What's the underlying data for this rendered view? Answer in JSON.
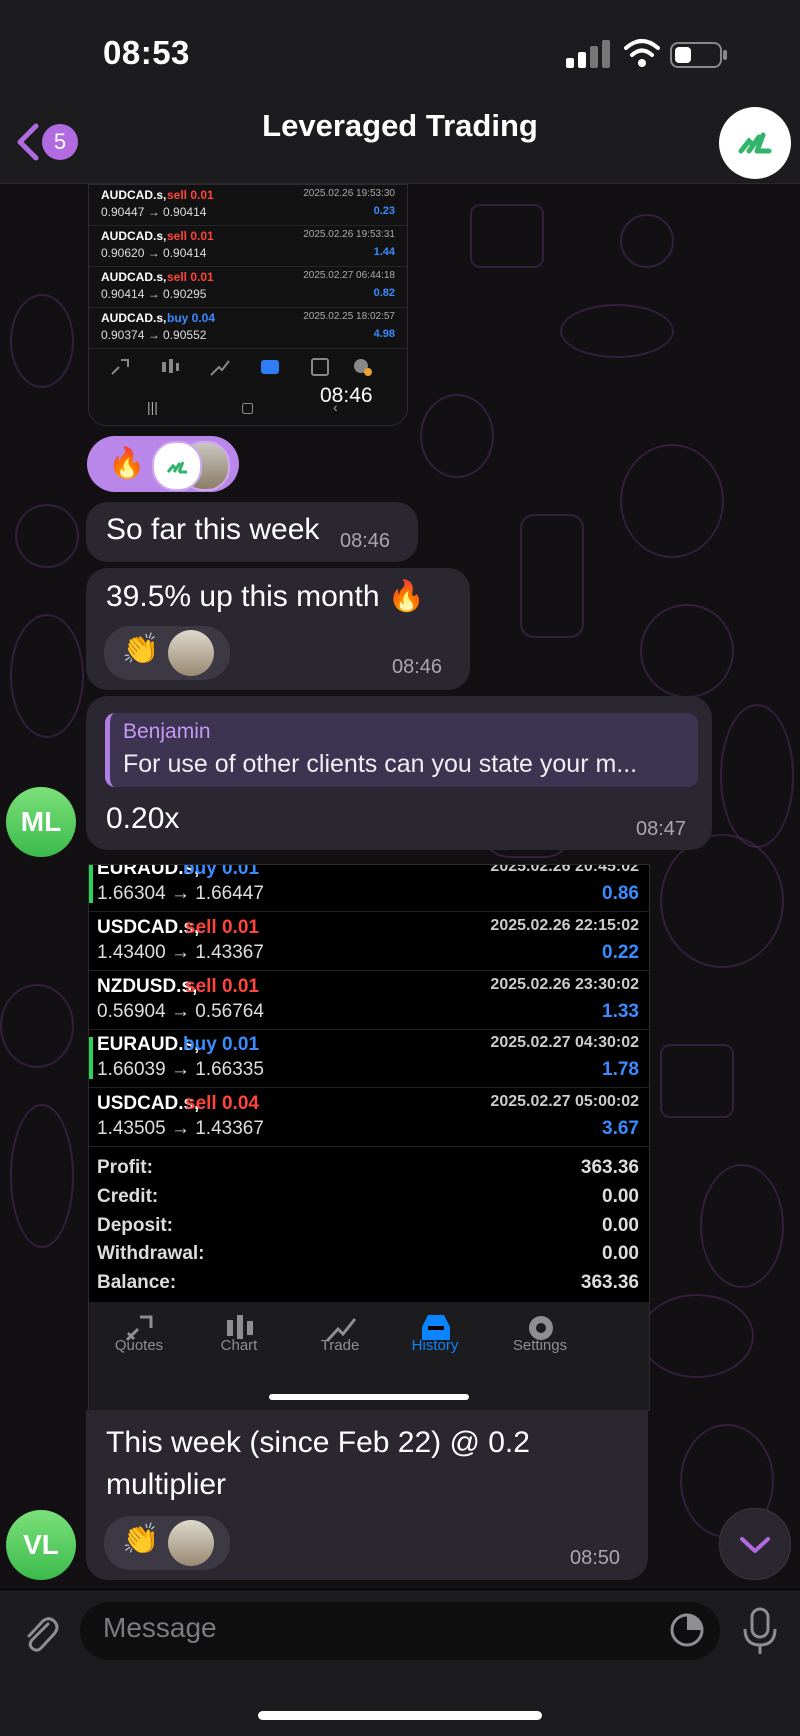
{
  "status": {
    "time": "08:53"
  },
  "header": {
    "title": "Leveraged Trading",
    "unread_count": "5"
  },
  "shot1": {
    "trades": [
      {
        "symbol": "AUDCAD.s,",
        "side": "sell 0.01",
        "prices": "0.90447 → 0.90414",
        "date": "2025.02.26 19:53:30",
        "profit": "0.23"
      },
      {
        "symbol": "AUDCAD.s,",
        "side": "sell 0.01",
        "prices": "0.90620 → 0.90414",
        "date": "2025.02.26 19:53:31",
        "profit": "1.44"
      },
      {
        "symbol": "AUDCAD.s,",
        "side": "sell 0.01",
        "prices": "0.90414 → 0.90295",
        "date": "2025.02.27 06:44:18",
        "profit": "0.82"
      },
      {
        "symbol": "AUDCAD.s,",
        "side": "buy 0.04",
        "prices": "0.90374 → 0.90552",
        "date": "2025.02.25 18:02:57",
        "profit": "4.98"
      }
    ],
    "time": "08:46"
  },
  "msg1": {
    "text": "So far this week",
    "time": "08:46"
  },
  "msg2": {
    "text": "39.5% up this month 🔥",
    "time": "08:46",
    "reaction": "👏"
  },
  "msg3": {
    "reply_name": "Benjamin",
    "reply_text": "For use of other clients can you state your m...",
    "text": "0.20x",
    "time": "08:47",
    "avatar": "ML"
  },
  "shot2": {
    "trades": [
      {
        "symbol": "EURAUD.s,",
        "side": "buy 0.01",
        "prices": "1.66304 → 1.66447",
        "date": "2025.02.26 20:45:02",
        "profit": "0.86",
        "bar": true
      },
      {
        "symbol": "USDCAD.s,",
        "side": "sell 0.01",
        "prices": "1.43400 → 1.43367",
        "date": "2025.02.26 22:15:02",
        "profit": "0.22",
        "bar": false
      },
      {
        "symbol": "NZDUSD.s,",
        "side": "sell 0.01",
        "prices": "0.56904 → 0.56764",
        "date": "2025.02.26 23:30:02",
        "profit": "1.33",
        "bar": false
      },
      {
        "symbol": "EURAUD.s,",
        "side": "buy 0.01",
        "prices": "1.66039 → 1.66335",
        "date": "2025.02.27 04:30:02",
        "profit": "1.78",
        "bar": true
      },
      {
        "symbol": "USDCAD.s,",
        "side": "sell 0.04",
        "prices": "1.43505 → 1.43367",
        "date": "2025.02.27 05:00:02",
        "profit": "3.67",
        "bar": false
      }
    ],
    "summary": [
      {
        "label": "Profit:",
        "value": "363.36"
      },
      {
        "label": "Credit:",
        "value": "0.00"
      },
      {
        "label": "Deposit:",
        "value": "0.00"
      },
      {
        "label": "Withdrawal:",
        "value": "0.00"
      },
      {
        "label": "Balance:",
        "value": "363.36"
      }
    ],
    "tabs": [
      "Quotes",
      "Chart",
      "Trade",
      "History",
      "Settings"
    ],
    "active_tab": "History"
  },
  "msg4": {
    "line1": "This week (since Feb 22) @ 0.2",
    "line2": "multiplier",
    "time": "08:50",
    "avatar": "VL",
    "reaction": "👏"
  },
  "input": {
    "placeholder": "Message"
  },
  "colors": {
    "accent": "#b26ae0",
    "sell": "#ff453a",
    "buy": "#3a8bff",
    "active_tab": "#0a84ff"
  }
}
